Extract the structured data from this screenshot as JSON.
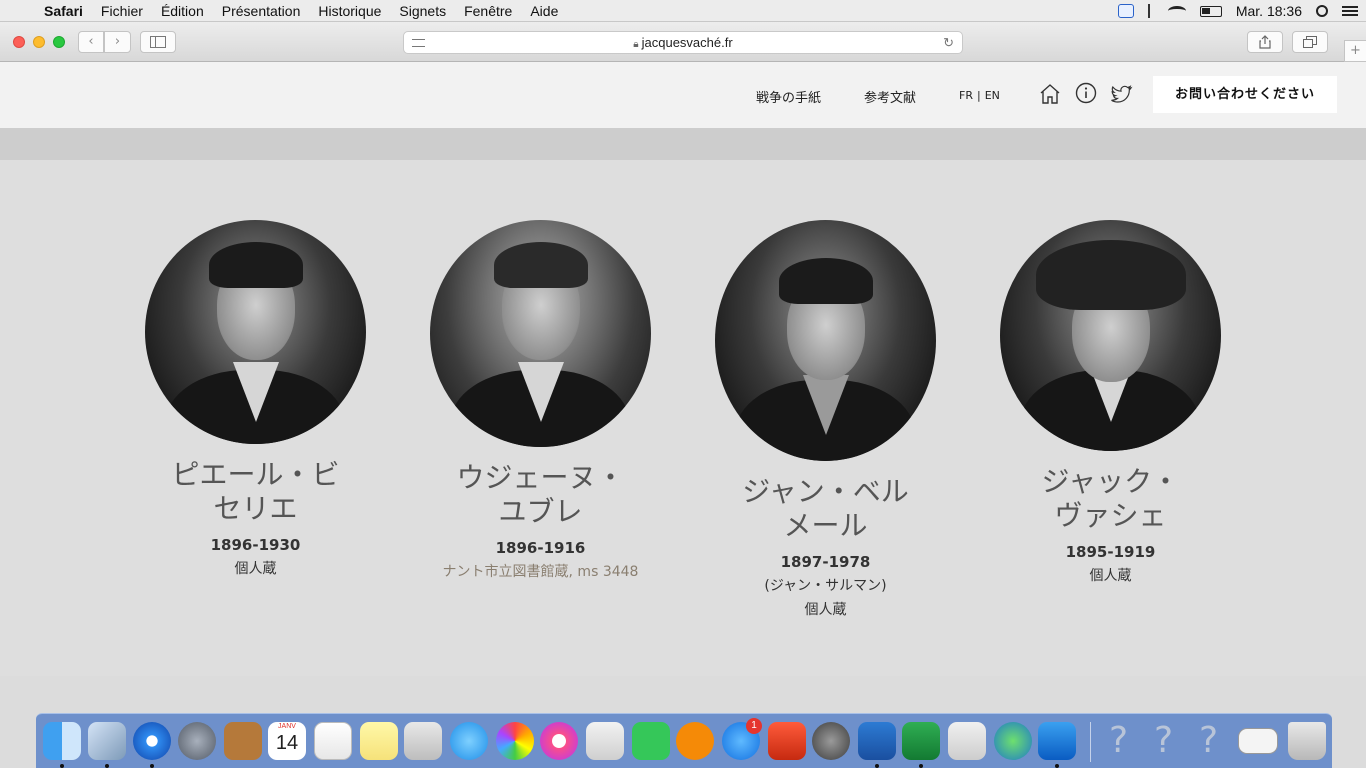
{
  "menubar": {
    "items": [
      "Safari",
      "Fichier",
      "Édition",
      "Présentation",
      "Historique",
      "Signets",
      "Fenêtre",
      "Aide"
    ],
    "clock": "Mar. 18:36"
  },
  "browser": {
    "url": "jacquesvaché.fr"
  },
  "header": {
    "nav": [
      "戦争の手紙",
      "参考文献"
    ],
    "lang_fr": "FR",
    "lang_sep": "|",
    "lang_en": "EN",
    "contact": "お問い合わせください"
  },
  "people": [
    {
      "name_line1": "ピエール・ビ",
      "name_line2": "セリエ",
      "years": "1896-1930",
      "note1": "個人蔵",
      "note2": ""
    },
    {
      "name_line1": "ウジェーヌ・",
      "name_line2": "ユブレ",
      "years": "1896-1916",
      "note1": "ナント市立図書館蔵, ms 3448",
      "note2": ""
    },
    {
      "name_line1": "ジャン・ベル",
      "name_line2": "メール",
      "years": "1897-1978",
      "note1": "(ジャン・サルマン)",
      "note2": "個人蔵"
    },
    {
      "name_line1": "ジャック・",
      "name_line2": "ヴァシェ",
      "years": "1895-1919",
      "note1": "個人蔵",
      "note2": ""
    }
  ],
  "dock": {
    "calendar_month": "JANV",
    "calendar_day": "14",
    "appstore_badge": "1",
    "unknown": "?"
  },
  "colors": {
    "accent_text": "#555555",
    "section_bg": "#dedede",
    "header_bg": "#f2f2f2",
    "note_tan": "#8a7f70"
  }
}
